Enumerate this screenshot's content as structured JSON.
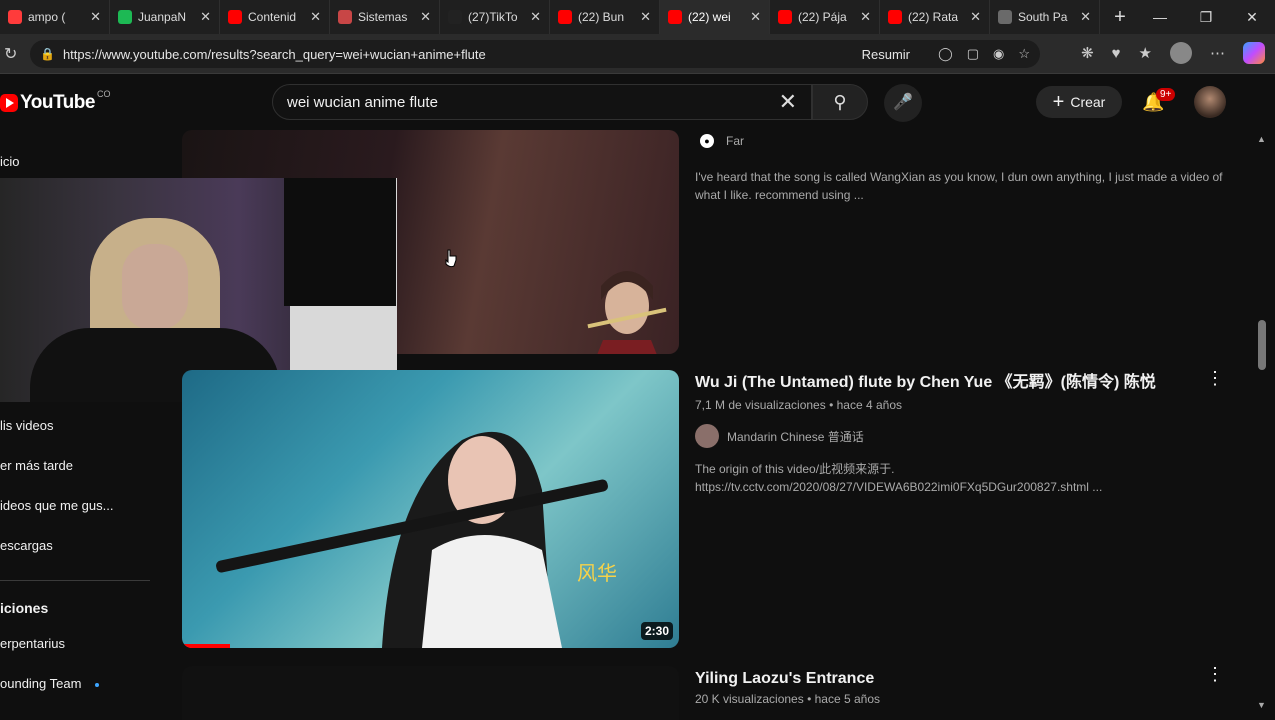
{
  "browser": {
    "tabs": [
      {
        "label": "ampo (",
        "color": "#ff3b3b"
      },
      {
        "label": "JuanpaN",
        "color": "#1db954"
      },
      {
        "label": "Contenid",
        "color": "#ff0000"
      },
      {
        "label": "Sistemas",
        "color": "#c84646"
      },
      {
        "label": "(27)TikTo",
        "color": "#222222"
      },
      {
        "label": "(22) Bun",
        "color": "#ff0000"
      },
      {
        "label": "(22) wei",
        "color": "#ff0000"
      },
      {
        "label": "(22) Pája",
        "color": "#ff0000"
      },
      {
        "label": "(22) Rata",
        "color": "#ff0000"
      },
      {
        "label": "South Pa",
        "color": "#6a6a6a"
      }
    ],
    "active_tab": 6,
    "url": "https://www.youtube.com/results?search_query=wei+wucian+anime+flute",
    "resumir": "Resumir"
  },
  "youtube": {
    "logo": "YouTube",
    "country": "CO",
    "search_query": "wei wucian anime flute",
    "create_label": "Crear",
    "notif_count": "9+"
  },
  "sidebar": {
    "inicio": "icio",
    "items": [
      "lis videos",
      "er más tarde",
      "ideos que me gus...",
      "escargas"
    ],
    "section": "iciones",
    "subs": [
      "erpentarius",
      "ounding Team"
    ]
  },
  "results": [
    {
      "channel": "Far",
      "desc": "I've heard that the song is called WangXian as you know, I dun own anything, I just made a video of what I like. recommend using ..."
    },
    {
      "title": "Wu Ji (The Untamed) flute by Chen Yue 《无羁》(陈情令) 陈悦",
      "views": "7,1 M de visualizaciones",
      "age": "hace 4 años",
      "channel": "Mandarin Chinese 普通话",
      "desc_line1": "The origin of this video/此视频来源于.",
      "desc_line2": "https://tv.cctv.com/2020/08/27/VIDEWA6B022imi0FXq5DGur200827.shtml ...",
      "duration": "2:30"
    },
    {
      "title": "Yiling Laozu's Entrance",
      "views": "20 K visualizaciones",
      "age": "hace 5 años"
    }
  ]
}
